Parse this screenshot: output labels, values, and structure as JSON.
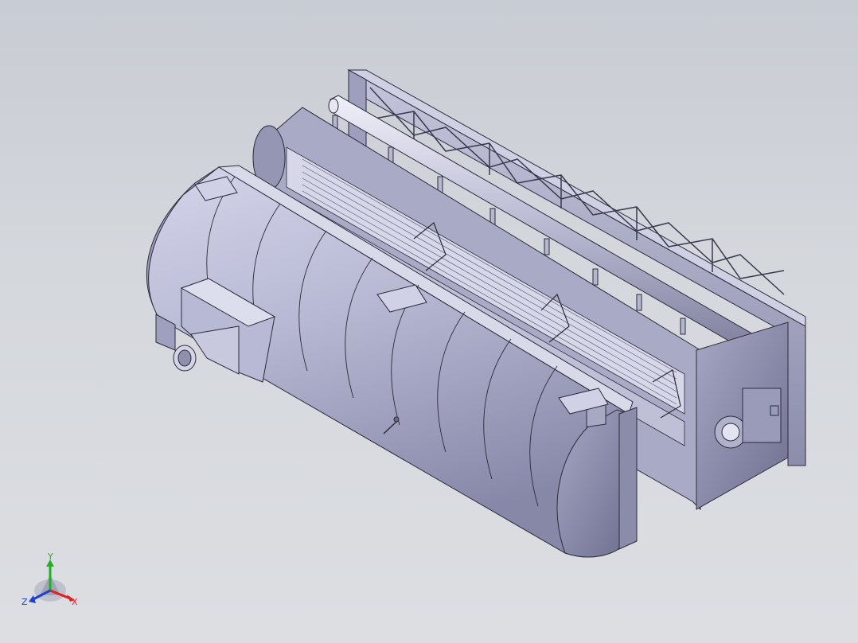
{
  "viewport": {
    "background_top": "#c8ccd3",
    "background_bottom": "#dcdee2"
  },
  "model": {
    "body_color": "#b8b9d2",
    "body_shade": "#8f90b0",
    "edge_color": "#2b2b3a",
    "frame_color": "#a9aac4"
  },
  "triad": {
    "x_label": "X",
    "y_label": "Y",
    "z_label": "Z",
    "x_color": "#e02020",
    "y_color": "#20b020",
    "z_color": "#2040d0"
  }
}
